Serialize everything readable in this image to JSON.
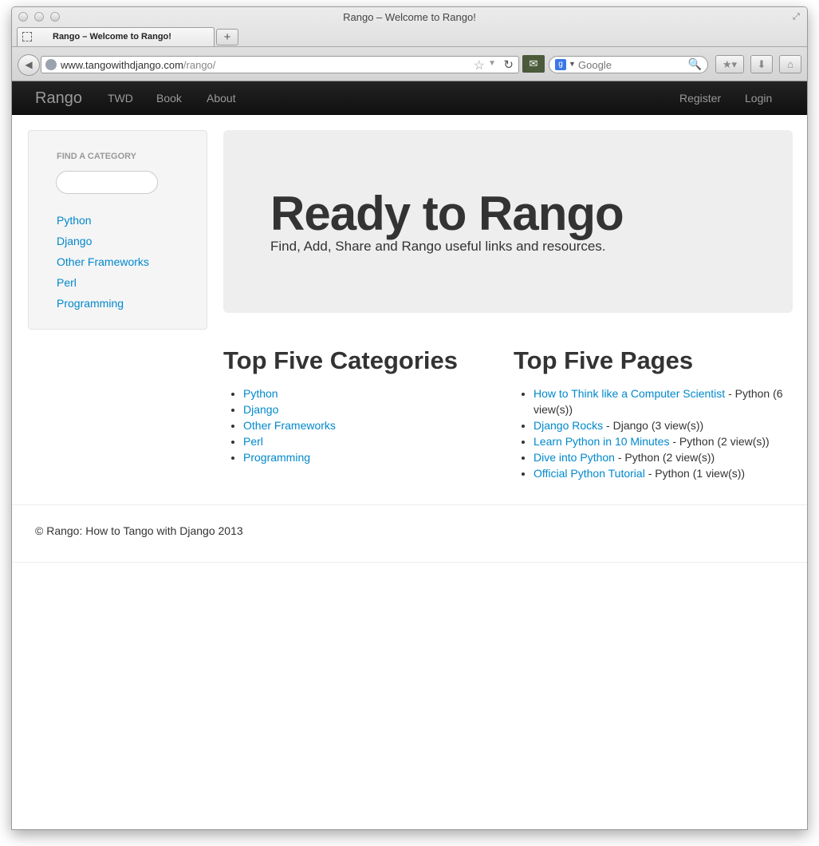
{
  "browser": {
    "window_title": "Rango – Welcome to Rango!",
    "tab_label": "Rango – Welcome to Rango!",
    "new_tab_label": "+",
    "url_host": "www.tangowithdjango.com",
    "url_path": "/rango/",
    "search_placeholder": "Google"
  },
  "navbar": {
    "brand": "Rango",
    "left_links": [
      "TWD",
      "Book",
      "About"
    ],
    "right_links": [
      "Register",
      "Login"
    ]
  },
  "sidebar": {
    "header": "FIND A CATEGORY",
    "search_value": "",
    "categories": [
      "Python",
      "Django",
      "Other Frameworks",
      "Perl",
      "Programming"
    ]
  },
  "hero": {
    "title": "Ready to Rango",
    "subtitle": "Find, Add, Share and Rango useful links and resources."
  },
  "top_categories": {
    "heading": "Top Five Categories",
    "items": [
      "Python",
      "Django",
      "Other Frameworks",
      "Perl",
      "Programming"
    ]
  },
  "top_pages": {
    "heading": "Top Five Pages",
    "items": [
      {
        "title": "How to Think like a Computer Scientist",
        "suffix": " - Python (6 view(s))"
      },
      {
        "title": "Django Rocks",
        "suffix": " - Django (3 view(s))"
      },
      {
        "title": "Learn Python in 10 Minutes",
        "suffix": " - Python (2 view(s))"
      },
      {
        "title": "Dive into Python",
        "suffix": " - Python (2 view(s))"
      },
      {
        "title": "Official Python Tutorial",
        "suffix": " - Python (1 view(s))"
      }
    ]
  },
  "footer": {
    "text": "© Rango: How to Tango with Django 2013"
  },
  "colors": {
    "link": "#0088cc",
    "navbar_bg": "#1b1b1b",
    "hero_bg": "#eeeeee",
    "sidebar_bg": "#f5f5f5"
  }
}
